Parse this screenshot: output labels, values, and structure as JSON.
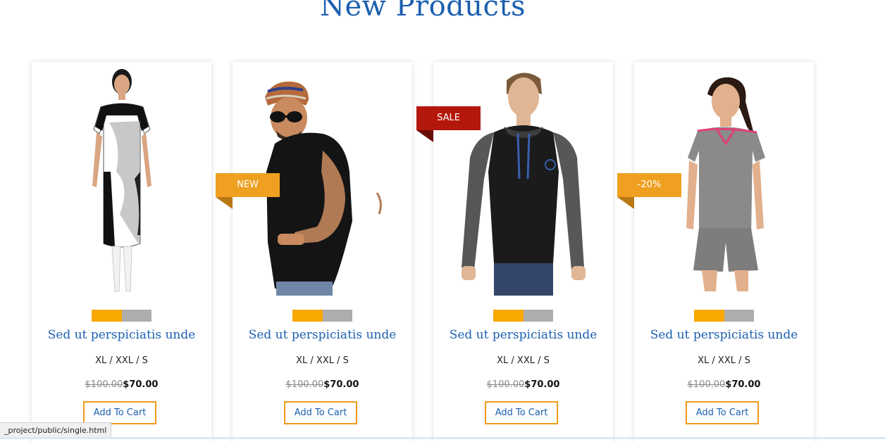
{
  "section": {
    "title": "New Products"
  },
  "products": [
    {
      "name": "Sed ut perspiciatis unde",
      "sizes": "XL / XXL / S",
      "old_price": "$100.00",
      "price": "$70.00",
      "button": "Add To Cart",
      "rating_fraction": 0.5
    },
    {
      "name": "Sed ut perspiciatis unde",
      "sizes": "XL / XXL / S",
      "old_price": "$100.00",
      "price": "$70.00",
      "button": "Add To Cart",
      "rating_fraction": 0.5
    },
    {
      "name": "Sed ut perspiciatis unde",
      "sizes": "XL / XXL / S",
      "old_price": "$100.00",
      "price": "$70.00",
      "button": "Add To Cart",
      "rating_fraction": 0.5
    },
    {
      "name": "Sed ut perspiciatis unde",
      "sizes": "XL / XXL / S",
      "old_price": "$100.00",
      "price": "$70.00",
      "button": "Add To Cart",
      "rating_fraction": 0.5
    }
  ],
  "ribbons": {
    "new": "NEW",
    "sale": "SALE",
    "discount": "-20%"
  },
  "status_bar": {
    "url": "_project/public/single.html"
  },
  "colors": {
    "accent_blue": "#1b5fb0",
    "orange": "#efa020",
    "sale_red": "#b4170c",
    "rating_fill": "#f9a800",
    "rating_empty": "#adadad"
  }
}
